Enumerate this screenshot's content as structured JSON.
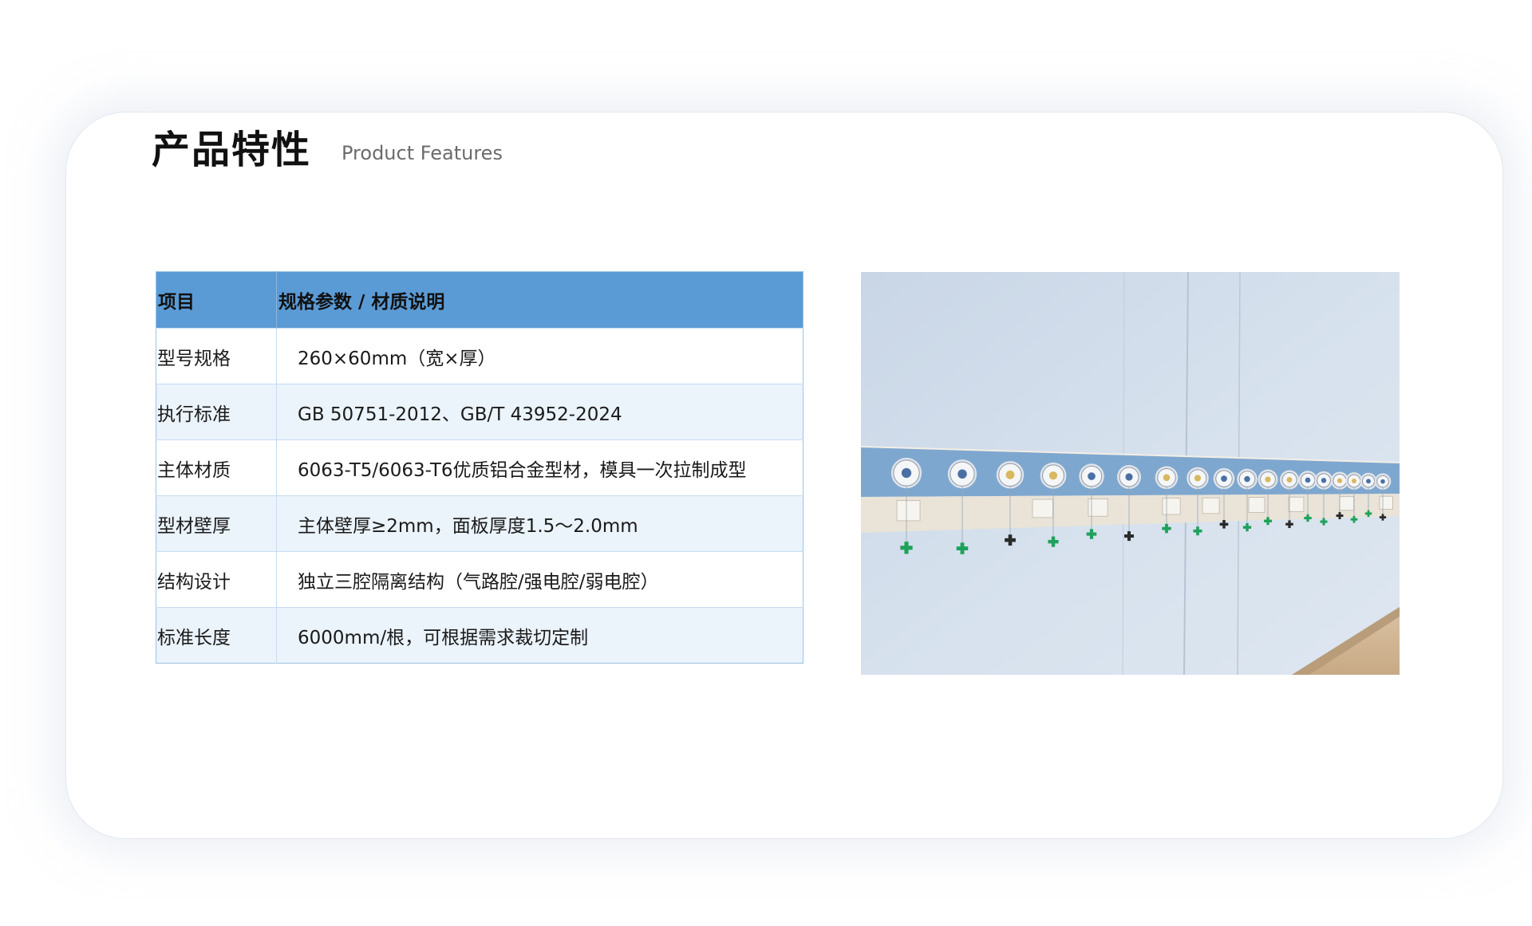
{
  "header": {
    "title": "产品特性",
    "subtitle": "Product Features"
  },
  "spec_table": {
    "columns": [
      "项目",
      "规格参数 / 材质说明"
    ],
    "rows": [
      {
        "item": "型号规格",
        "value": "260×60mm（宽×厚）"
      },
      {
        "item": "执行标准",
        "value": "GB 50751-2012、GB/T 43952-2024"
      },
      {
        "item": "主体材质",
        "value": "6063-T5/6063-T6优质铝合金型材，模具一次拉制成型"
      },
      {
        "item": "型材壁厚",
        "value": "主体壁厚≥2mm，面板厚度1.5～2.0mm"
      },
      {
        "item": "结构设计",
        "value": "独立三腔隔离结构（气路腔/强电腔/弱电腔）"
      },
      {
        "item": "标准长度",
        "value": "6000mm/根，可根据需求裁切定制"
      }
    ]
  },
  "colors": {
    "header_row": "#5b9bd5",
    "alt_row": "#ebf3fb",
    "border": "#9dc3e6"
  }
}
